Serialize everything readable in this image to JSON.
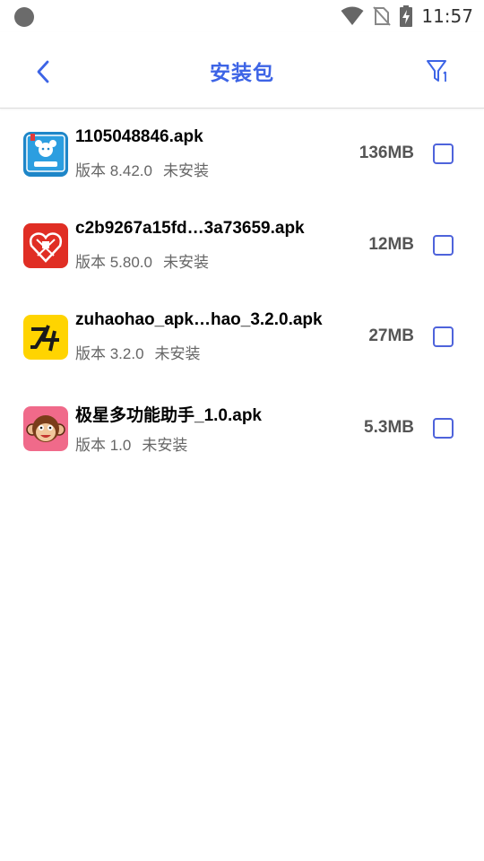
{
  "status_bar": {
    "time": "11:57"
  },
  "toolbar": {
    "title": "安装包"
  },
  "apps": [
    {
      "name": "1105048846.apk",
      "version": "版本 8.42.0",
      "status": "未安装",
      "size": "136MB",
      "icon": "migu-book-icon"
    },
    {
      "name": "c2b9267a15fd…3a73659.apk",
      "version": "版本 5.80.0",
      "status": "未安装",
      "size": "12MB",
      "icon": "pinduoduo-icon"
    },
    {
      "name": "zuhaohao_apk…hao_3.2.0.apk",
      "version": "版本 3.2.0",
      "status": "未安装",
      "size": "27MB",
      "icon": "zuhaohao-icon"
    },
    {
      "name": "极星多功能助手_1.0.apk",
      "version": "版本 1.0",
      "status": "未安装",
      "size": "5.3MB",
      "icon": "monkey-icon"
    }
  ],
  "colors": {
    "accent": "#3d64e6",
    "checkbox": "#4e63db"
  }
}
